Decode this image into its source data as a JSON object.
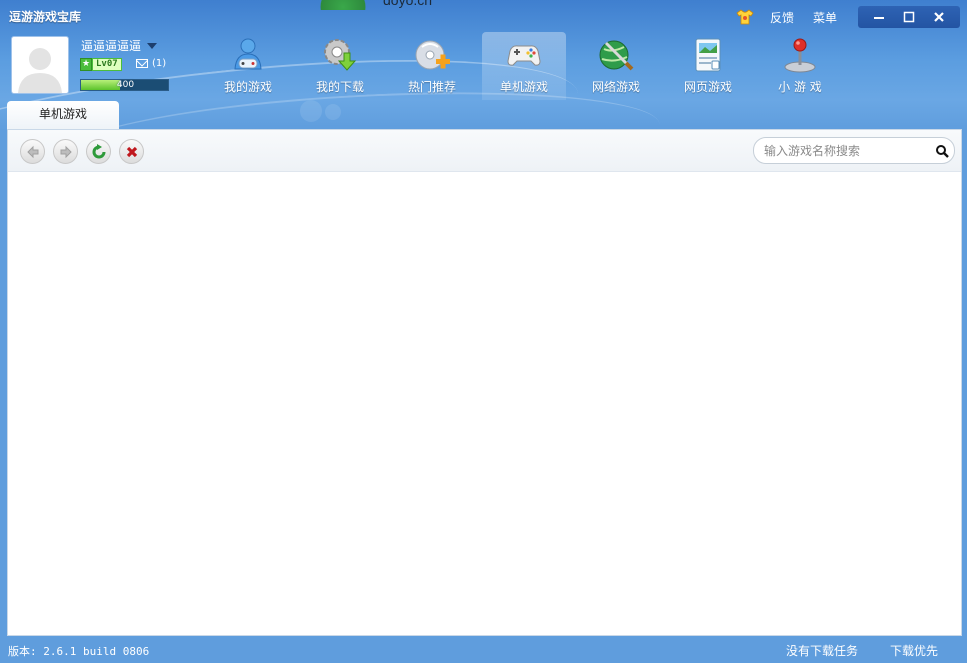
{
  "app": {
    "title": "逗游游戏宝库",
    "top_deco_text": "doyo.cn"
  },
  "header": {
    "feedback_label": "反馈",
    "menu_label": "菜单"
  },
  "user": {
    "name": "逼逼逼逼逼",
    "level_text": "Lv07",
    "mail_count": "(1)",
    "exp_value": "400",
    "exp_fill_percent": 45
  },
  "nav": {
    "items": [
      {
        "label": "我的游戏",
        "icon": "my-games-icon"
      },
      {
        "label": "我的下载",
        "icon": "download-gear-icon"
      },
      {
        "label": "热门推荐",
        "icon": "hot-disc-icon"
      },
      {
        "label": "单机游戏",
        "icon": "gamepad-icon",
        "active": true
      },
      {
        "label": "网络游戏",
        "icon": "online-globe-sword-icon"
      },
      {
        "label": "网页游戏",
        "icon": "web-page-icon"
      },
      {
        "label": "小 游 戏",
        "icon": "joystick-icon"
      }
    ]
  },
  "tab": {
    "label": "单机游戏"
  },
  "toolbar": {
    "search_placeholder": "输入游戏名称搜索"
  },
  "status": {
    "version": "版本: 2.6.1 build 0806",
    "no_tasks": "没有下载任务",
    "download_priority": "下载优先"
  },
  "colors": {
    "brand_blue": "#4a8fd6",
    "title_bar": "#3f7fcf",
    "exp_green": "#5cc32b",
    "stop_red": "#c0171c",
    "refresh_green": "#2e9a3a"
  }
}
